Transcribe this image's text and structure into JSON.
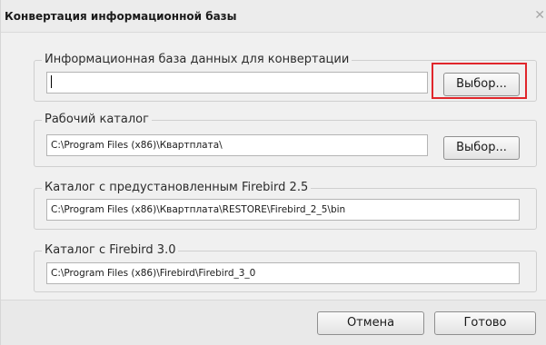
{
  "dialog": {
    "title": "Конвертация информационной базы",
    "close_glyph": "✕"
  },
  "groups": {
    "infobase": {
      "legend": "Информационная база данных для конвертации",
      "value": "",
      "browse_label": "Выбор..."
    },
    "workdir": {
      "legend": "Рабочий каталог",
      "value": "C:\\Program Files (x86)\\Квартплата\\",
      "browse_label": "Выбор..."
    },
    "firebird25": {
      "legend": "Каталог с предустановленным Firebird 2.5",
      "value": "C:\\Program Files (x86)\\Квартплата\\RESTORE\\Firebird_2_5\\bin"
    },
    "firebird30": {
      "legend": "Каталог с Firebird 3.0",
      "value": "C:\\Program Files (x86)\\Firebird\\Firebird_3_0"
    }
  },
  "footer": {
    "cancel_label": "Отмена",
    "done_label": "Готово"
  },
  "colors": {
    "highlight": "#e0262b"
  }
}
